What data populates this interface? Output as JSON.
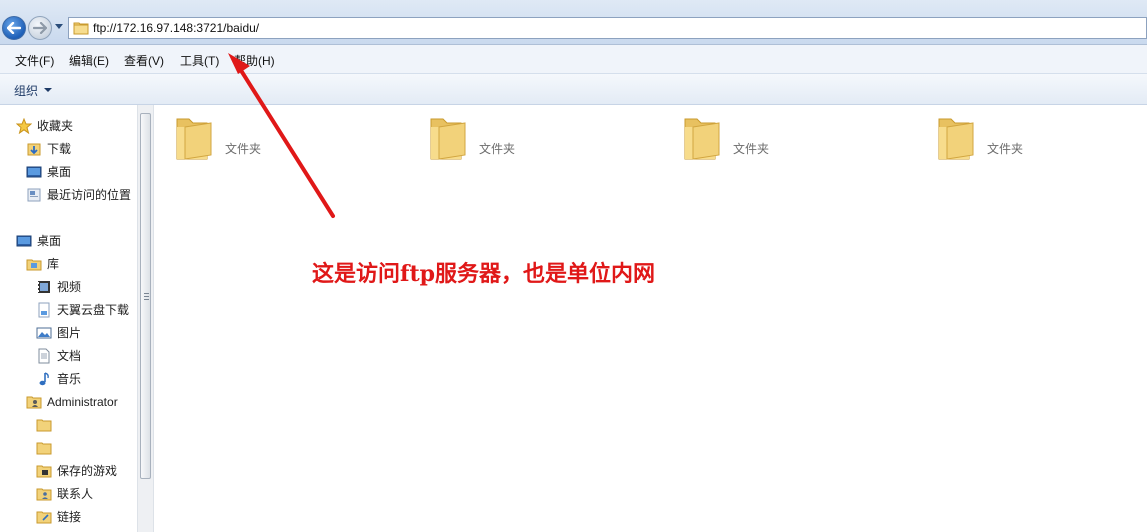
{
  "address": {
    "path": "ftp://172.16.97.148:3721/baidu/"
  },
  "menu": [
    "文件(F)",
    "编辑(E)",
    "查看(V)",
    "工具(T)",
    "帮助(H)"
  ],
  "toolbar": {
    "organize": "组织"
  },
  "nav": {
    "favorites": "收藏夹",
    "downloads": "下载",
    "desktop_fav": "桌面",
    "recent": "最近访问的位置",
    "desktop": "桌面",
    "libraries": "库",
    "videos": "视频",
    "tianyi": "天翼云盘下载",
    "pictures": "图片",
    "documents": "文档",
    "music": "音乐",
    "admin": "Administrator",
    "saved_games": "保存的游戏",
    "contacts": "联系人",
    "links": "链接"
  },
  "folders": [
    {
      "type": "文件夹"
    },
    {
      "type": "文件夹"
    },
    {
      "type": "文件夹"
    },
    {
      "type": "文件夹"
    }
  ],
  "annotation": "这是访问ftp服务器，也是单位内网",
  "colors": {
    "annotation": "#e01818",
    "folder": "#f2d27a"
  }
}
